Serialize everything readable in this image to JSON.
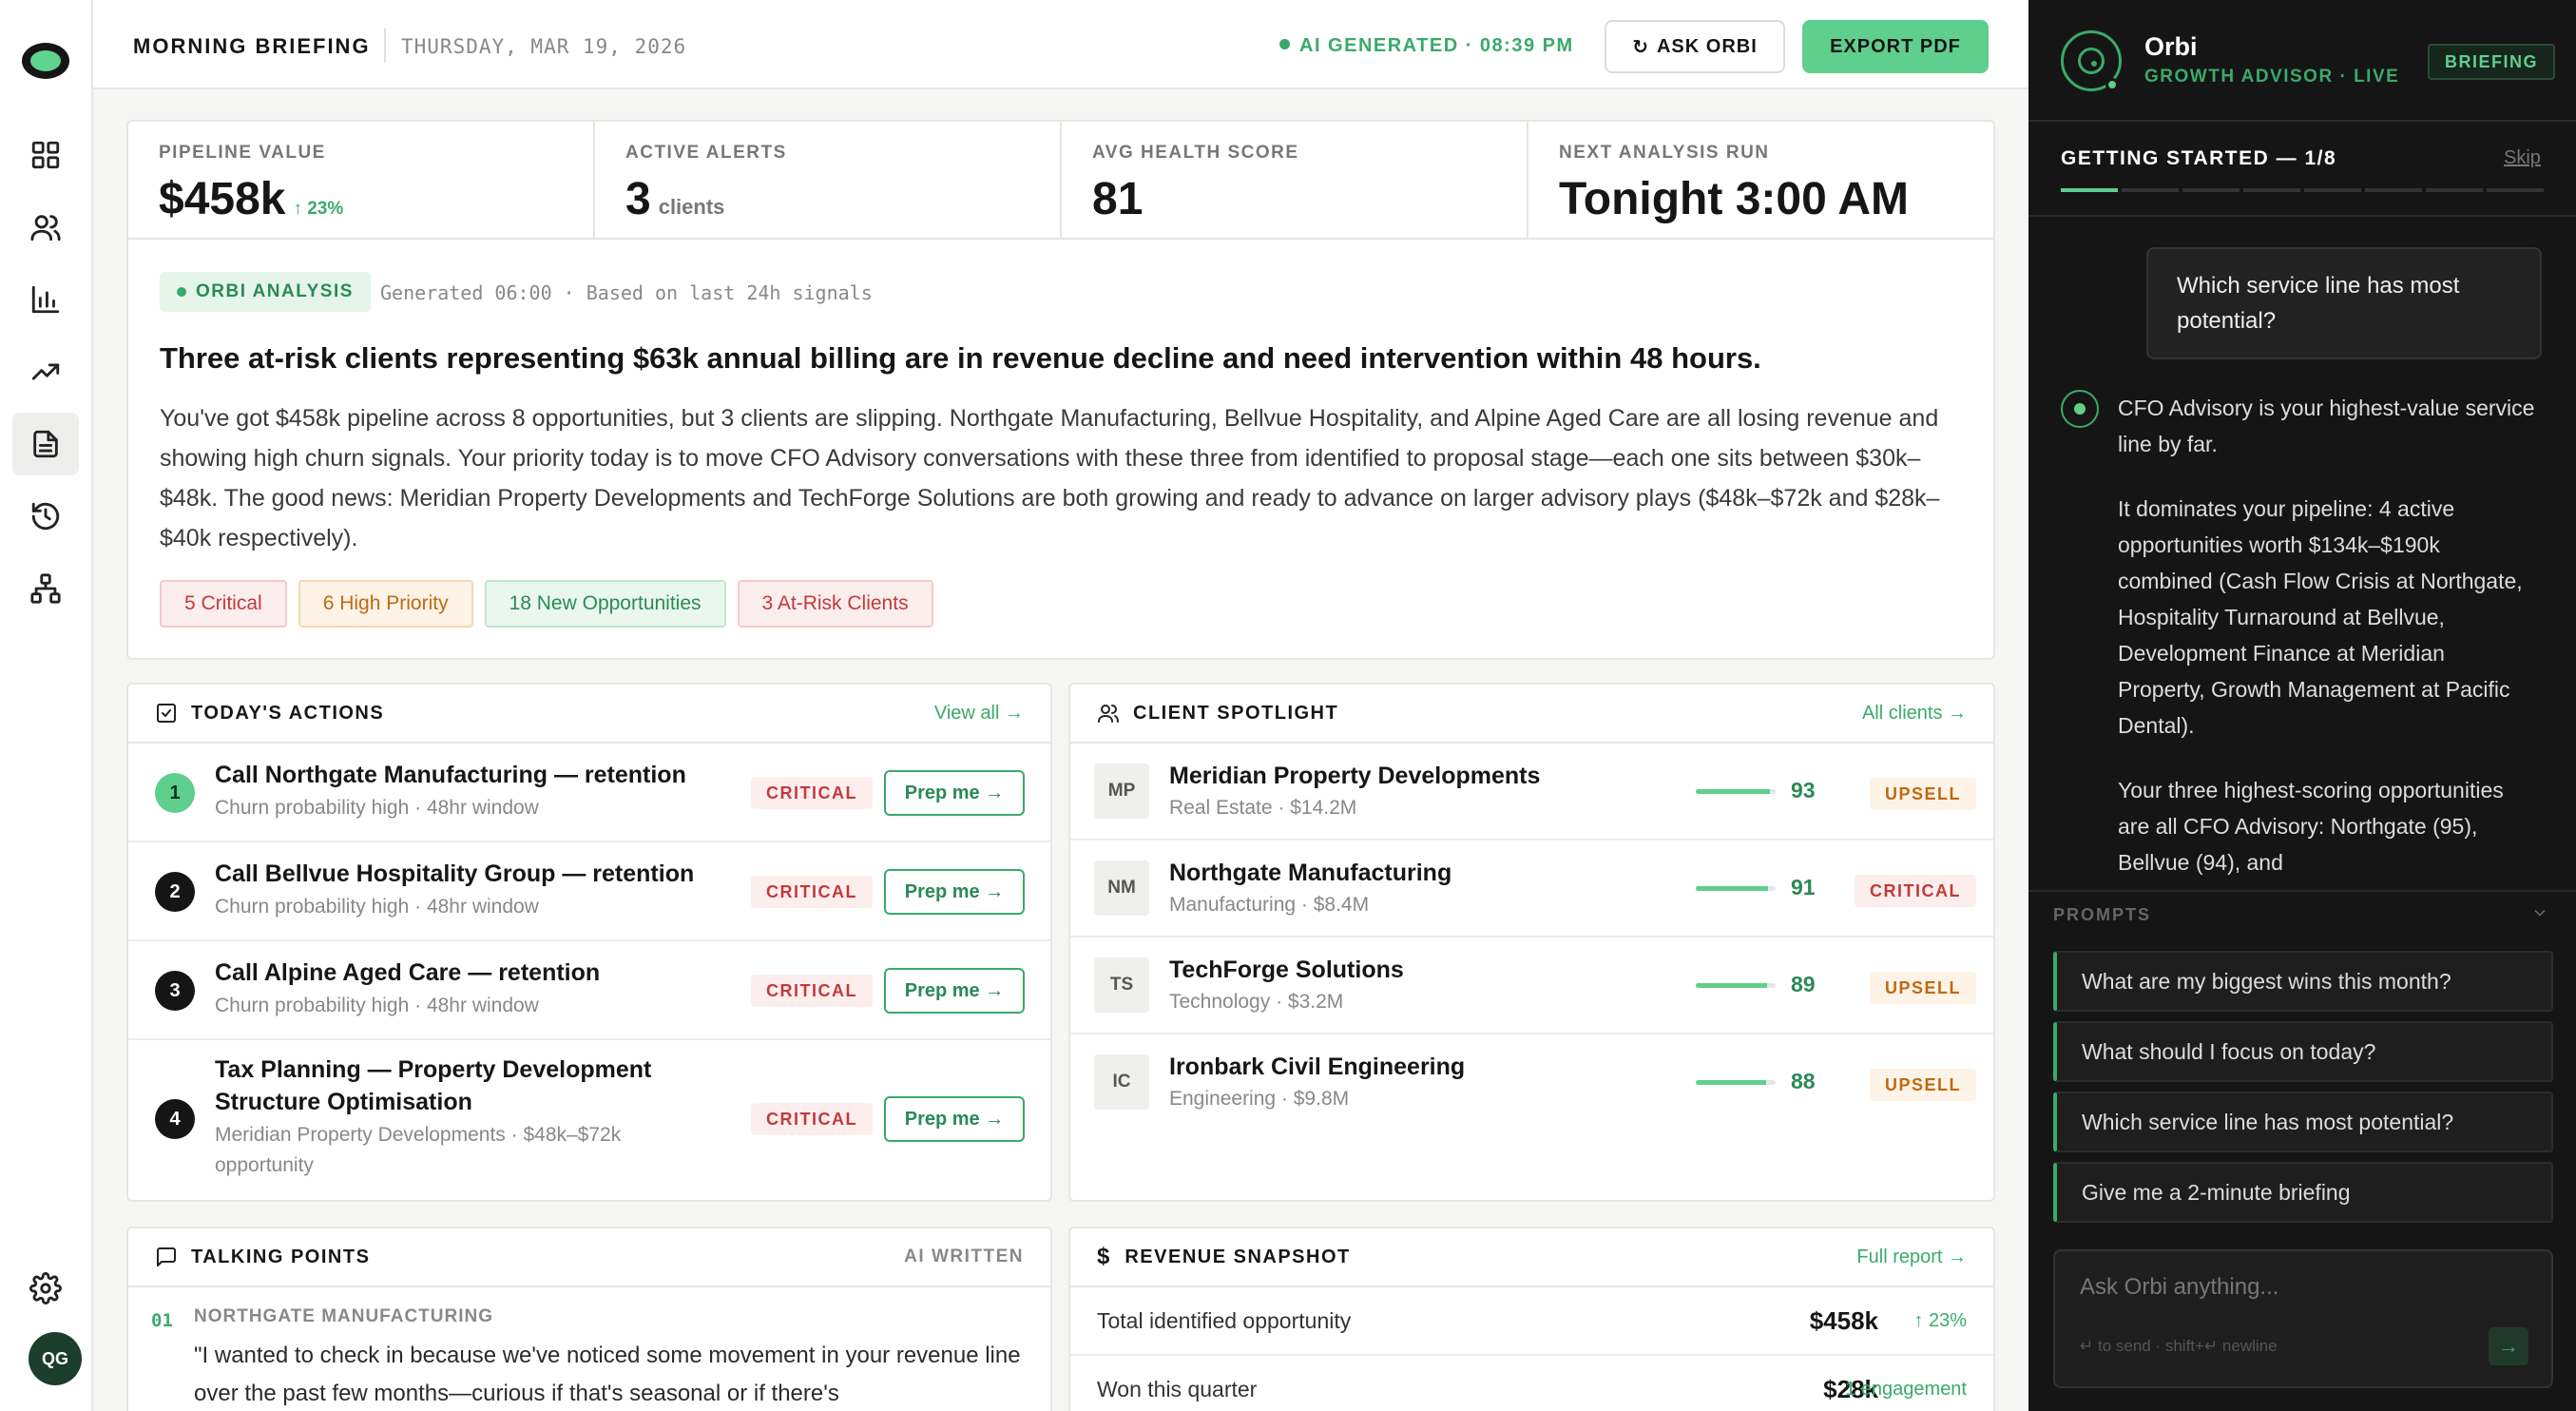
{
  "header": {
    "title": "MORNING BRIEFING",
    "date": "THURSDAY, MAR 19, 2026",
    "ai_status": "AI GENERATED · 08:39 PM",
    "ask_label": "ASK ORBI",
    "export_label": "EXPORT PDF"
  },
  "rail": {
    "nav": [
      "dashboard-icon",
      "clients-icon",
      "bar-chart-icon",
      "trend-icon",
      "briefing-icon",
      "history-icon",
      "hierarchy-icon",
      "settings-icon"
    ],
    "avatar_initials": "QG"
  },
  "stats": [
    {
      "label": "PIPELINE VALUE",
      "value": "$458k",
      "delta": "↑ 23%",
      "sub": ""
    },
    {
      "label": "ACTIVE ALERTS",
      "value": "3",
      "delta": "",
      "sub": "clients"
    },
    {
      "label": "AVG HEALTH SCORE",
      "value": "81",
      "delta": "",
      "sub": ""
    },
    {
      "label": "NEXT ANALYSIS RUN",
      "value": "Tonight 3:00 AM",
      "delta": "",
      "sub": ""
    }
  ],
  "analysis": {
    "badge": "ORBI ANALYSIS",
    "note": "Generated 06:00 · Based on last 24h signals",
    "headline": "Three at-risk clients representing $63k annual billing are in revenue decline and need intervention within 48 hours.",
    "summary": "You've got $458k pipeline across 8 opportunities, but 3 clients are slipping. Northgate Manufacturing, Bellvue Hospitality, and Alpine Aged Care are all losing revenue and showing high churn signals. Your priority today is to move CFO Advisory conversations with these three from identified to proposal stage—each one sits between $30k–$48k. The good news: Meridian Property Developments and TechForge Solutions are both growing and ready to advance on larger advisory plays ($48k–$72k and $28k–$40k respectively).",
    "tags": [
      {
        "label": "5 Critical",
        "kind": "crit"
      },
      {
        "label": "6 High Priority",
        "kind": "high"
      },
      {
        "label": "18 New Opportunities",
        "kind": "new"
      },
      {
        "label": "3 At-Risk Clients",
        "kind": "crit"
      }
    ]
  },
  "actions": {
    "title": "TODAY'S ACTIONS",
    "link": "View all →",
    "items": [
      {
        "num": "1",
        "title": "Call Northgate Manufacturing — retention",
        "sub": "Churn probability high · 48hr window",
        "badge": "CRITICAL",
        "button": "Prep me →"
      },
      {
        "num": "2",
        "title": "Call Bellvue Hospitality Group — retention",
        "sub": "Churn probability high · 48hr window",
        "badge": "CRITICAL",
        "button": "Prep me →"
      },
      {
        "num": "3",
        "title": "Call Alpine Aged Care — retention",
        "sub": "Churn probability high · 48hr window",
        "badge": "CRITICAL",
        "button": "Prep me →"
      },
      {
        "num": "4",
        "title": "Tax Planning — Property Development Structure Optimisation",
        "sub": "Meridian Property Developments · $48k–$72k opportunity",
        "badge": "CRITICAL",
        "button": "Prep me →"
      }
    ]
  },
  "spotlight": {
    "title": "CLIENT SPOTLIGHT",
    "link": "All clients →",
    "clients": [
      {
        "initials": "MP",
        "name": "Meridian Property Developments",
        "sub": "Real Estate · $14.2M",
        "score": 93,
        "tag": "UPSELL",
        "kind": "upsell"
      },
      {
        "initials": "NM",
        "name": "Northgate Manufacturing",
        "sub": "Manufacturing · $8.4M",
        "score": 91,
        "tag": "CRITICAL",
        "kind": "critical"
      },
      {
        "initials": "TS",
        "name": "TechForge Solutions",
        "sub": "Technology · $3.2M",
        "score": 89,
        "tag": "UPSELL",
        "kind": "upsell"
      },
      {
        "initials": "IC",
        "name": "Ironbark Civil Engineering",
        "sub": "Engineering · $9.8M",
        "score": 88,
        "tag": "UPSELL",
        "kind": "upsell"
      }
    ]
  },
  "talking": {
    "title": "TALKING POINTS",
    "meta": "AI WRITTEN",
    "items": [
      {
        "num": "01",
        "client": "NORTHGATE MANUFACTURING",
        "quote": "\"I wanted to check in because we've noticed some movement in your revenue line over the past few months—curious if that's seasonal or if there's"
      }
    ]
  },
  "revenue": {
    "title": "REVENUE SNAPSHOT",
    "link": "Full report →",
    "rows": [
      {
        "label": "Total identified opportunity",
        "value": "$458k",
        "extra": "↑ 23%"
      },
      {
        "label": "Won this quarter",
        "value": "$28k",
        "extra": "1 engagement"
      }
    ]
  },
  "panel": {
    "name": "Orbi",
    "sub": "GROWTH ADVISOR · LIVE",
    "badge": "BRIEFING",
    "getting_started": "GETTING STARTED — 1/8",
    "skip": "Skip",
    "steps_total": 8,
    "steps_done": 1,
    "user_message": "Which service line has most potential?",
    "bot_paragraphs": [
      "CFO Advisory is your highest-value service line by far.",
      "It dominates your pipeline: 4 active opportunities worth $134k–$190k combined (Cash Flow Crisis at Northgate, Hospitality Turnaround at Bellvue, Development Finance at Meridian Property, Growth Management at Pacific Dental).",
      "Your three highest-scoring opportunities are all CFO Advisory: Northgate (95), Bellvue (94), and"
    ],
    "prompts_label": "PROMPTS",
    "prompts": [
      "What are my biggest wins this month?",
      "What should I focus on today?",
      "Which service line has most potential?",
      "Give me a 2-minute briefing"
    ],
    "input_placeholder": "Ask Orbi anything...",
    "input_hint": "↵ to send · shift+↵ newline",
    "send_label": "→"
  }
}
